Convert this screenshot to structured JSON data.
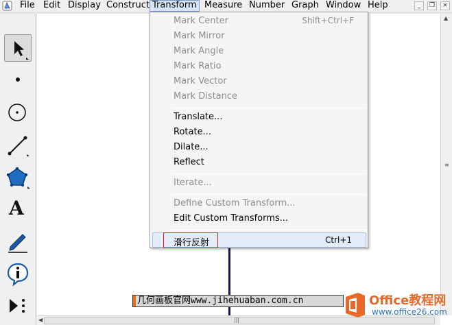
{
  "menubar": {
    "items": [
      "File",
      "Edit",
      "Display",
      "Construct",
      "Transform",
      "Measure",
      "Number",
      "Graph",
      "Window",
      "Help"
    ],
    "active_item": "Transform"
  },
  "window_controls": {
    "minimize": "_",
    "restore": "❐",
    "close": "×"
  },
  "toolbox": {
    "tools": [
      "arrow-select-tool",
      "point-tool",
      "compass-tool",
      "straightedge-tool",
      "polygon-tool",
      "text-tool",
      "marker-tool",
      "information-tool",
      "custom-tool"
    ],
    "text_tool_glyph": "A"
  },
  "transform_menu": {
    "items": [
      {
        "label": "Mark Center",
        "shortcut": "Shift+Ctrl+F",
        "enabled": false
      },
      {
        "label": "Mark Mirror",
        "shortcut": "",
        "enabled": false
      },
      {
        "label": "Mark Angle",
        "shortcut": "",
        "enabled": false
      },
      {
        "label": "Mark Ratio",
        "shortcut": "",
        "enabled": false
      },
      {
        "label": "Mark Vector",
        "shortcut": "",
        "enabled": false
      },
      {
        "label": "Mark Distance",
        "shortcut": "",
        "enabled": false
      },
      {
        "label": "Translate...",
        "shortcut": "",
        "enabled": true
      },
      {
        "label": "Rotate...",
        "shortcut": "",
        "enabled": true
      },
      {
        "label": "Dilate...",
        "shortcut": "",
        "enabled": true
      },
      {
        "label": "Reflect",
        "shortcut": "",
        "enabled": true
      },
      {
        "label": "Iterate...",
        "shortcut": "",
        "enabled": false
      },
      {
        "label": "Define Custom Transform...",
        "shortcut": "",
        "enabled": false
      },
      {
        "label": "Edit Custom Transforms...",
        "shortcut": "",
        "enabled": true
      },
      {
        "label": "滑行反射",
        "shortcut": "Ctrl+1",
        "enabled": true
      }
    ]
  },
  "watermark": {
    "site_text": "几何画板官网www.jihehuaban.com.cn",
    "office_title": "Office教程网",
    "office_url": "www.office26.com"
  },
  "colors": {
    "segment": "#14145a",
    "highlight_box": "#e02020",
    "office_orange": "#e8682a",
    "office_blue": "#2f71c4"
  }
}
